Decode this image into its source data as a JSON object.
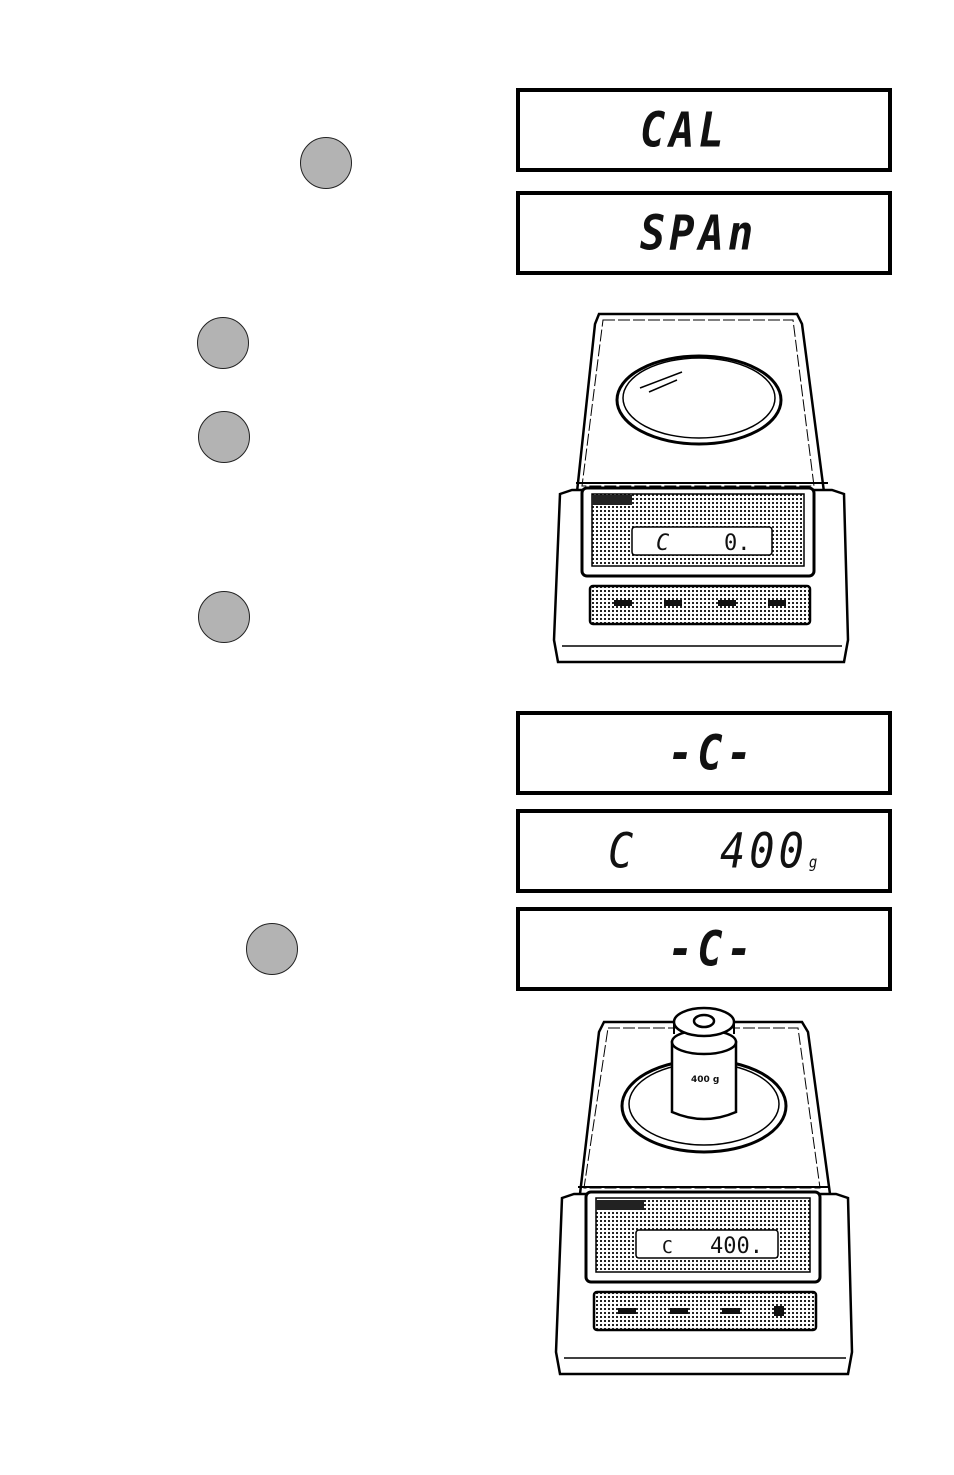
{
  "step_markers": [
    {
      "id": "step-1",
      "color": "#b3b3b3"
    },
    {
      "id": "step-2",
      "color": "#b3b3b3"
    },
    {
      "id": "step-3",
      "color": "#b3b3b3"
    },
    {
      "id": "step-4",
      "color": "#b3b3b3"
    },
    {
      "id": "step-5",
      "color": "#b3b3b3"
    }
  ],
  "displays": [
    {
      "text": "CAL"
    },
    {
      "text": "SPAn"
    },
    {
      "text": "-C-"
    },
    {
      "left": "C",
      "value": "400",
      "unit": "g"
    },
    {
      "text": "-C-"
    }
  ],
  "scale_illustrations": [
    {
      "readout_left": "C",
      "readout_value": "0."
    },
    {
      "readout_left": "C",
      "readout_value": "400.",
      "weight_label": "400 g"
    }
  ]
}
